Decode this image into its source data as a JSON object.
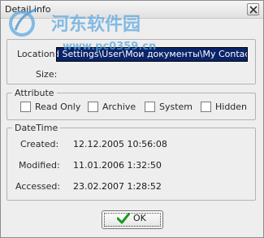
{
  "window": {
    "title": "Detail info"
  },
  "watermark": {
    "line1": "河东软件园",
    "line2": "www.pc0359.cn"
  },
  "location_group": {
    "location_label": "Location:",
    "location_value": "d Settings\\User\\Мои документы\\My Contacts",
    "size_label": "Size:",
    "size_value": ""
  },
  "attribute_group": {
    "legend": "Attribute",
    "read_only": "Read Only",
    "archive": "Archive",
    "system": "System",
    "hidden": "Hidden"
  },
  "datetime_group": {
    "legend": "DateTime",
    "created_label": "Created:",
    "created_value": "12.12.2005 10:56:08",
    "modified_label": "Modified:",
    "modified_value": "11.01.2006 1:32:50",
    "accessed_label": "Accessed:",
    "accessed_value": "23.02.2007 1:28:52"
  },
  "buttons": {
    "ok_label": "OK"
  },
  "colors": {
    "selection": "#0a246a",
    "check_green": "#1e9a1e",
    "watermark_blue": "#5aa7e0"
  },
  "icons": {
    "close": "close-icon",
    "ok": "checkmark-icon",
    "logo": "watermark-logo"
  }
}
